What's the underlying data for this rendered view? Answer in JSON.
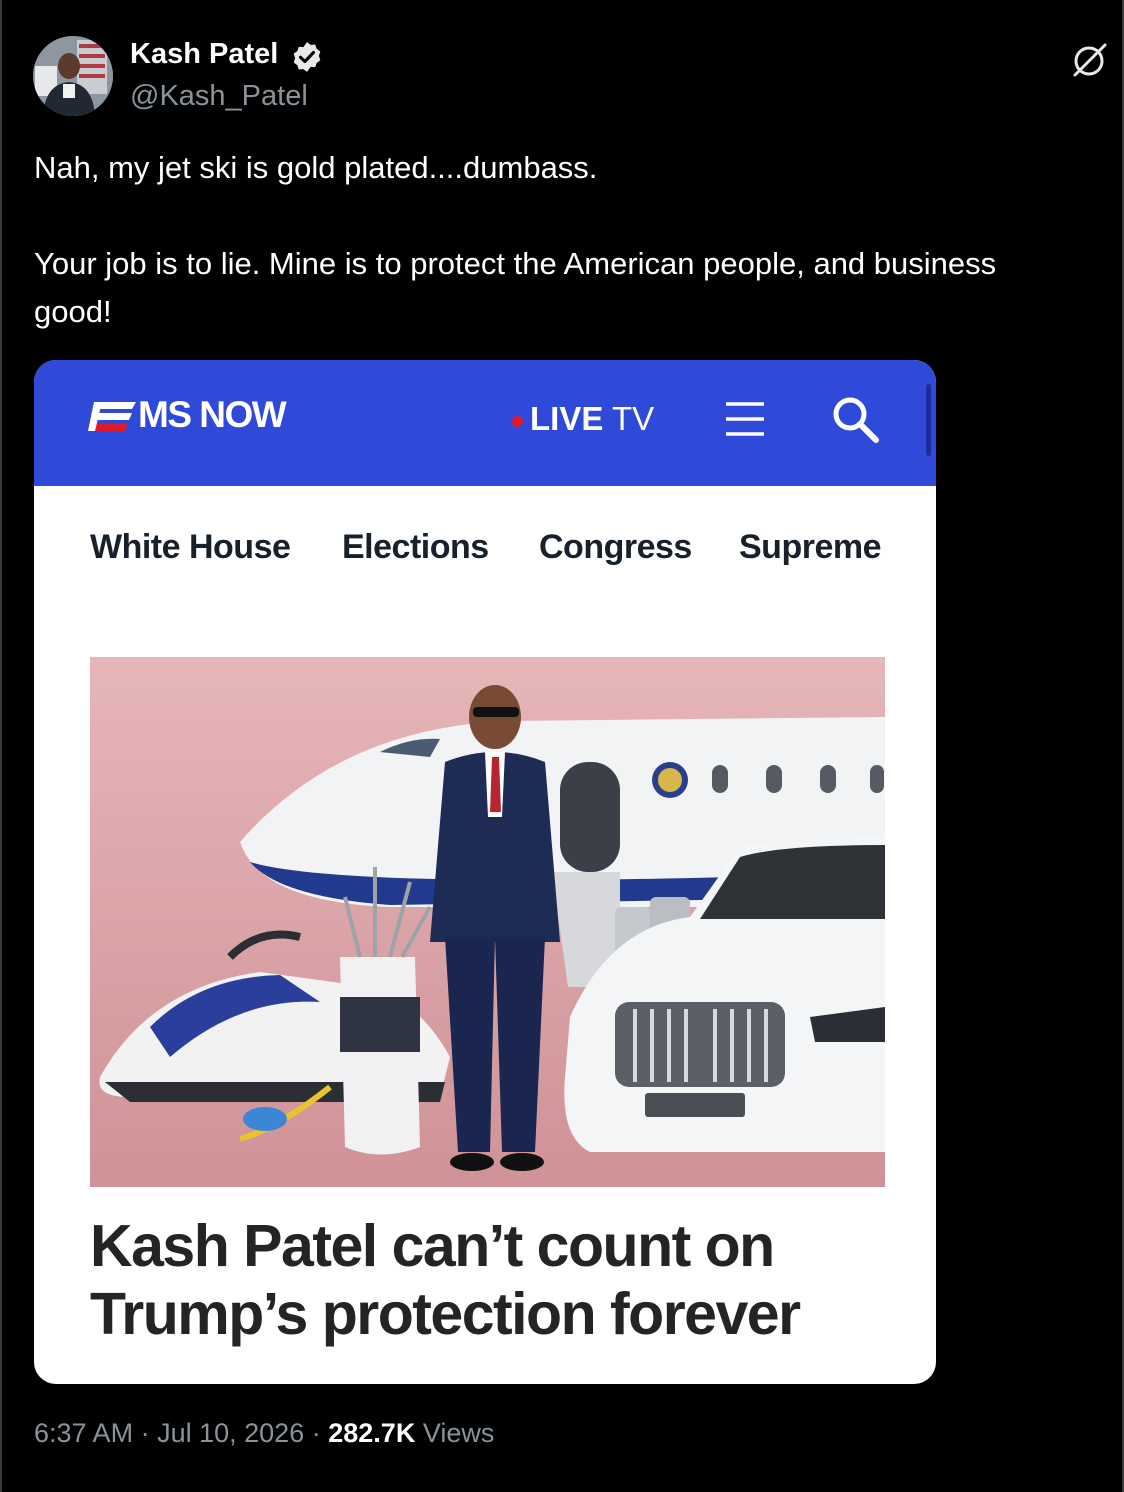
{
  "author": {
    "name": "Kash Patel",
    "handle": "@Kash_Patel",
    "verified": true
  },
  "tweet": {
    "line1": "Nah, my jet ski is gold plated....dumbass.",
    "line2": "Your job is to lie. Mine is to protect the American people, and business",
    "line3": "good!"
  },
  "card": {
    "brand": "MS NOW",
    "live_dot": "•",
    "live_label": "LIVE",
    "live_suffix": "TV",
    "subnav": [
      "White House",
      "Elections",
      "Congress",
      "Supreme"
    ],
    "headline_line1": "Kash Patel can’t count on",
    "headline_line2": "Trump’s protection forever"
  },
  "meta": {
    "time": "6:37 AM",
    "separator": "·",
    "date": "Jul 10, 2026",
    "views_count": "282.7K",
    "views_label": "Views"
  },
  "colors": {
    "background": "#000000",
    "nav_blue": "#2f49d8",
    "muted_text": "#8b939a",
    "live_red": "#e01a2a",
    "hero_pink": "#d9a3a7"
  },
  "icons": [
    "verified-badge-icon",
    "grok-icon",
    "ms-now-logo-icon",
    "menu-icon",
    "search-icon"
  ]
}
